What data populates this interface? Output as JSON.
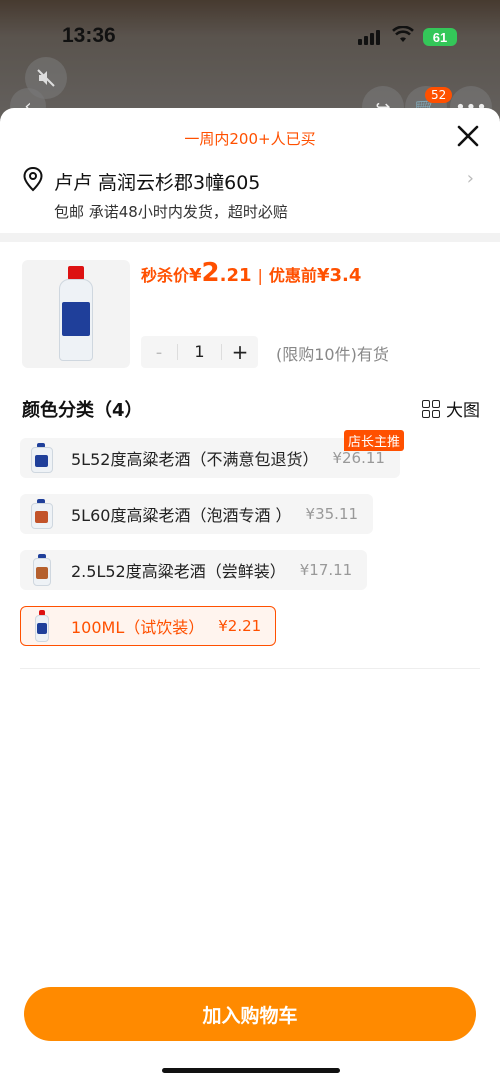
{
  "status_bar": {
    "time": "13:36",
    "battery": "61"
  },
  "background": {
    "cart_count": "52"
  },
  "sheet": {
    "sold_tip": "一周内200+人已买",
    "address": "卢卢 高润云杉郡3幢605",
    "shipping": "包邮 承诺48小时内发货，超时必赔",
    "price": {
      "label": "秒杀价",
      "currency": "¥",
      "int": "2",
      "dec": ".21",
      "before_label": "优惠前",
      "before_price": "¥3.4"
    },
    "quantity": "1",
    "stock_text": "(限购10件)有货",
    "sku_title": "颜色分类（4）",
    "big_pic_label": "大图",
    "skus": [
      {
        "name": "5L52度高粱老酒（不满意包退货）",
        "price": "¥26.11",
        "tag": "店长主推"
      },
      {
        "name": "5L60度高粱老酒（泡酒专酒 ）",
        "price": "¥35.11"
      },
      {
        "name": "2.5L52度高粱老酒（尝鲜装）",
        "price": "¥17.11"
      },
      {
        "name": "100ML（试饮装）",
        "price": "¥2.21",
        "selected": true
      }
    ],
    "cart_button": "加入购物车"
  },
  "colors": {
    "accent": "#ff5000",
    "button": "#ff8a00"
  }
}
